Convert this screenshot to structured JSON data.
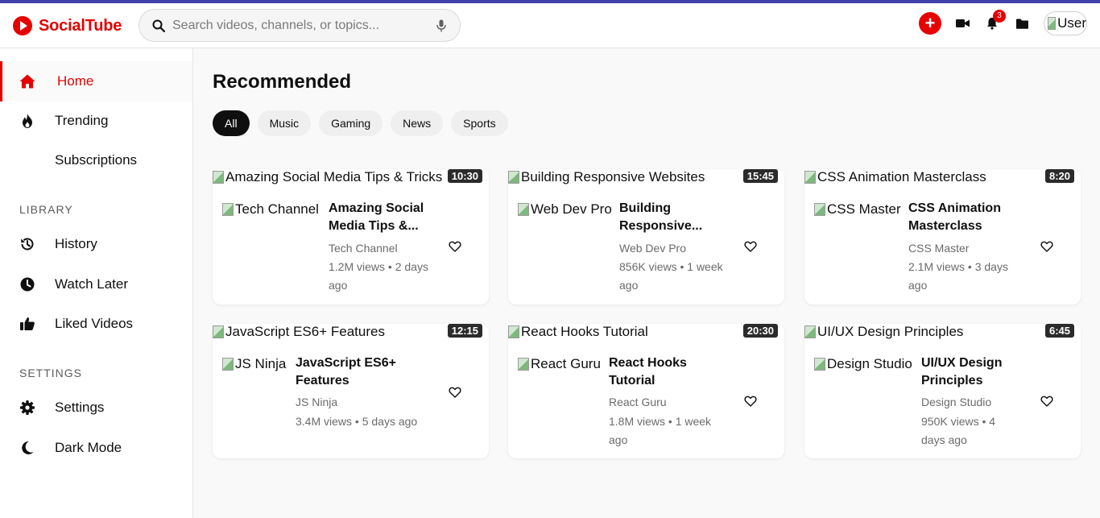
{
  "brand": {
    "name": "SocialTube",
    "color": "#e60000"
  },
  "search": {
    "placeholder": "Search videos, channels, or topics..."
  },
  "header": {
    "create_icon": "plus-icon",
    "notifications_count": "3",
    "avatar_alt": "User"
  },
  "sidebar": {
    "main": [
      {
        "label": "Home",
        "icon": "home-icon",
        "active": true
      },
      {
        "label": "Trending",
        "icon": "fire-icon"
      },
      {
        "label": "Subscriptions",
        "icon": ""
      }
    ],
    "library_heading": "LIBRARY",
    "library": [
      {
        "label": "History",
        "icon": "history-icon"
      },
      {
        "label": "Watch Later",
        "icon": "clock-icon"
      },
      {
        "label": "Liked Videos",
        "icon": "thumbs-up-icon"
      }
    ],
    "settings_heading": "SETTINGS",
    "settings": [
      {
        "label": "Settings",
        "icon": "gear-icon"
      },
      {
        "label": "Dark Mode",
        "icon": "moon-icon"
      }
    ]
  },
  "main": {
    "title": "Recommended",
    "chips": [
      "All",
      "Music",
      "Gaming",
      "News",
      "Sports"
    ],
    "videos": [
      {
        "thumb_alt": "Amazing Social Media Tips & Tricks",
        "duration": "10:30",
        "channel_alt": "Tech Channel",
        "title_line1": "Amazing Social",
        "title_line2": "Media Tips &...",
        "channel": "Tech Channel",
        "meta_line1": "1.2M views • 2 days",
        "meta_line2": "ago"
      },
      {
        "thumb_alt": "Building Responsive Websites",
        "duration": "15:45",
        "channel_alt": "Web Dev Pro",
        "title_line1": "Building",
        "title_line2": "Responsive...",
        "channel": "Web Dev Pro",
        "meta_line1": "856K views • 1 week",
        "meta_line2": "ago"
      },
      {
        "thumb_alt": "CSS Animation Masterclass",
        "duration": "8:20",
        "channel_alt": "CSS Master",
        "title_line1": "CSS Animation",
        "title_line2": "Masterclass",
        "channel": "CSS Master",
        "meta_line1": "2.1M views • 3 days",
        "meta_line2": "ago"
      },
      {
        "thumb_alt": "JavaScript ES6+ Features",
        "duration": "12:15",
        "channel_alt": "JS Ninja",
        "title_line1": "JavaScript ES6+",
        "title_line2": "Features",
        "channel": "JS Ninja",
        "meta_line1": "3.4M views • 5 days ago",
        "meta_line2": ""
      },
      {
        "thumb_alt": "React Hooks Tutorial",
        "duration": "20:30",
        "channel_alt": "React Guru",
        "title_line1": "React Hooks",
        "title_line2": "Tutorial",
        "channel": "React Guru",
        "meta_line1": "1.8M views • 1 week",
        "meta_line2": "ago"
      },
      {
        "thumb_alt": "UI/UX Design Principles",
        "duration": "6:45",
        "channel_alt": "Design Studio",
        "title_line1": "UI/UX Design",
        "title_line2": "Principles",
        "channel": "Design Studio",
        "meta_line1": "950K views • 4",
        "meta_line2": "days ago"
      }
    ]
  }
}
